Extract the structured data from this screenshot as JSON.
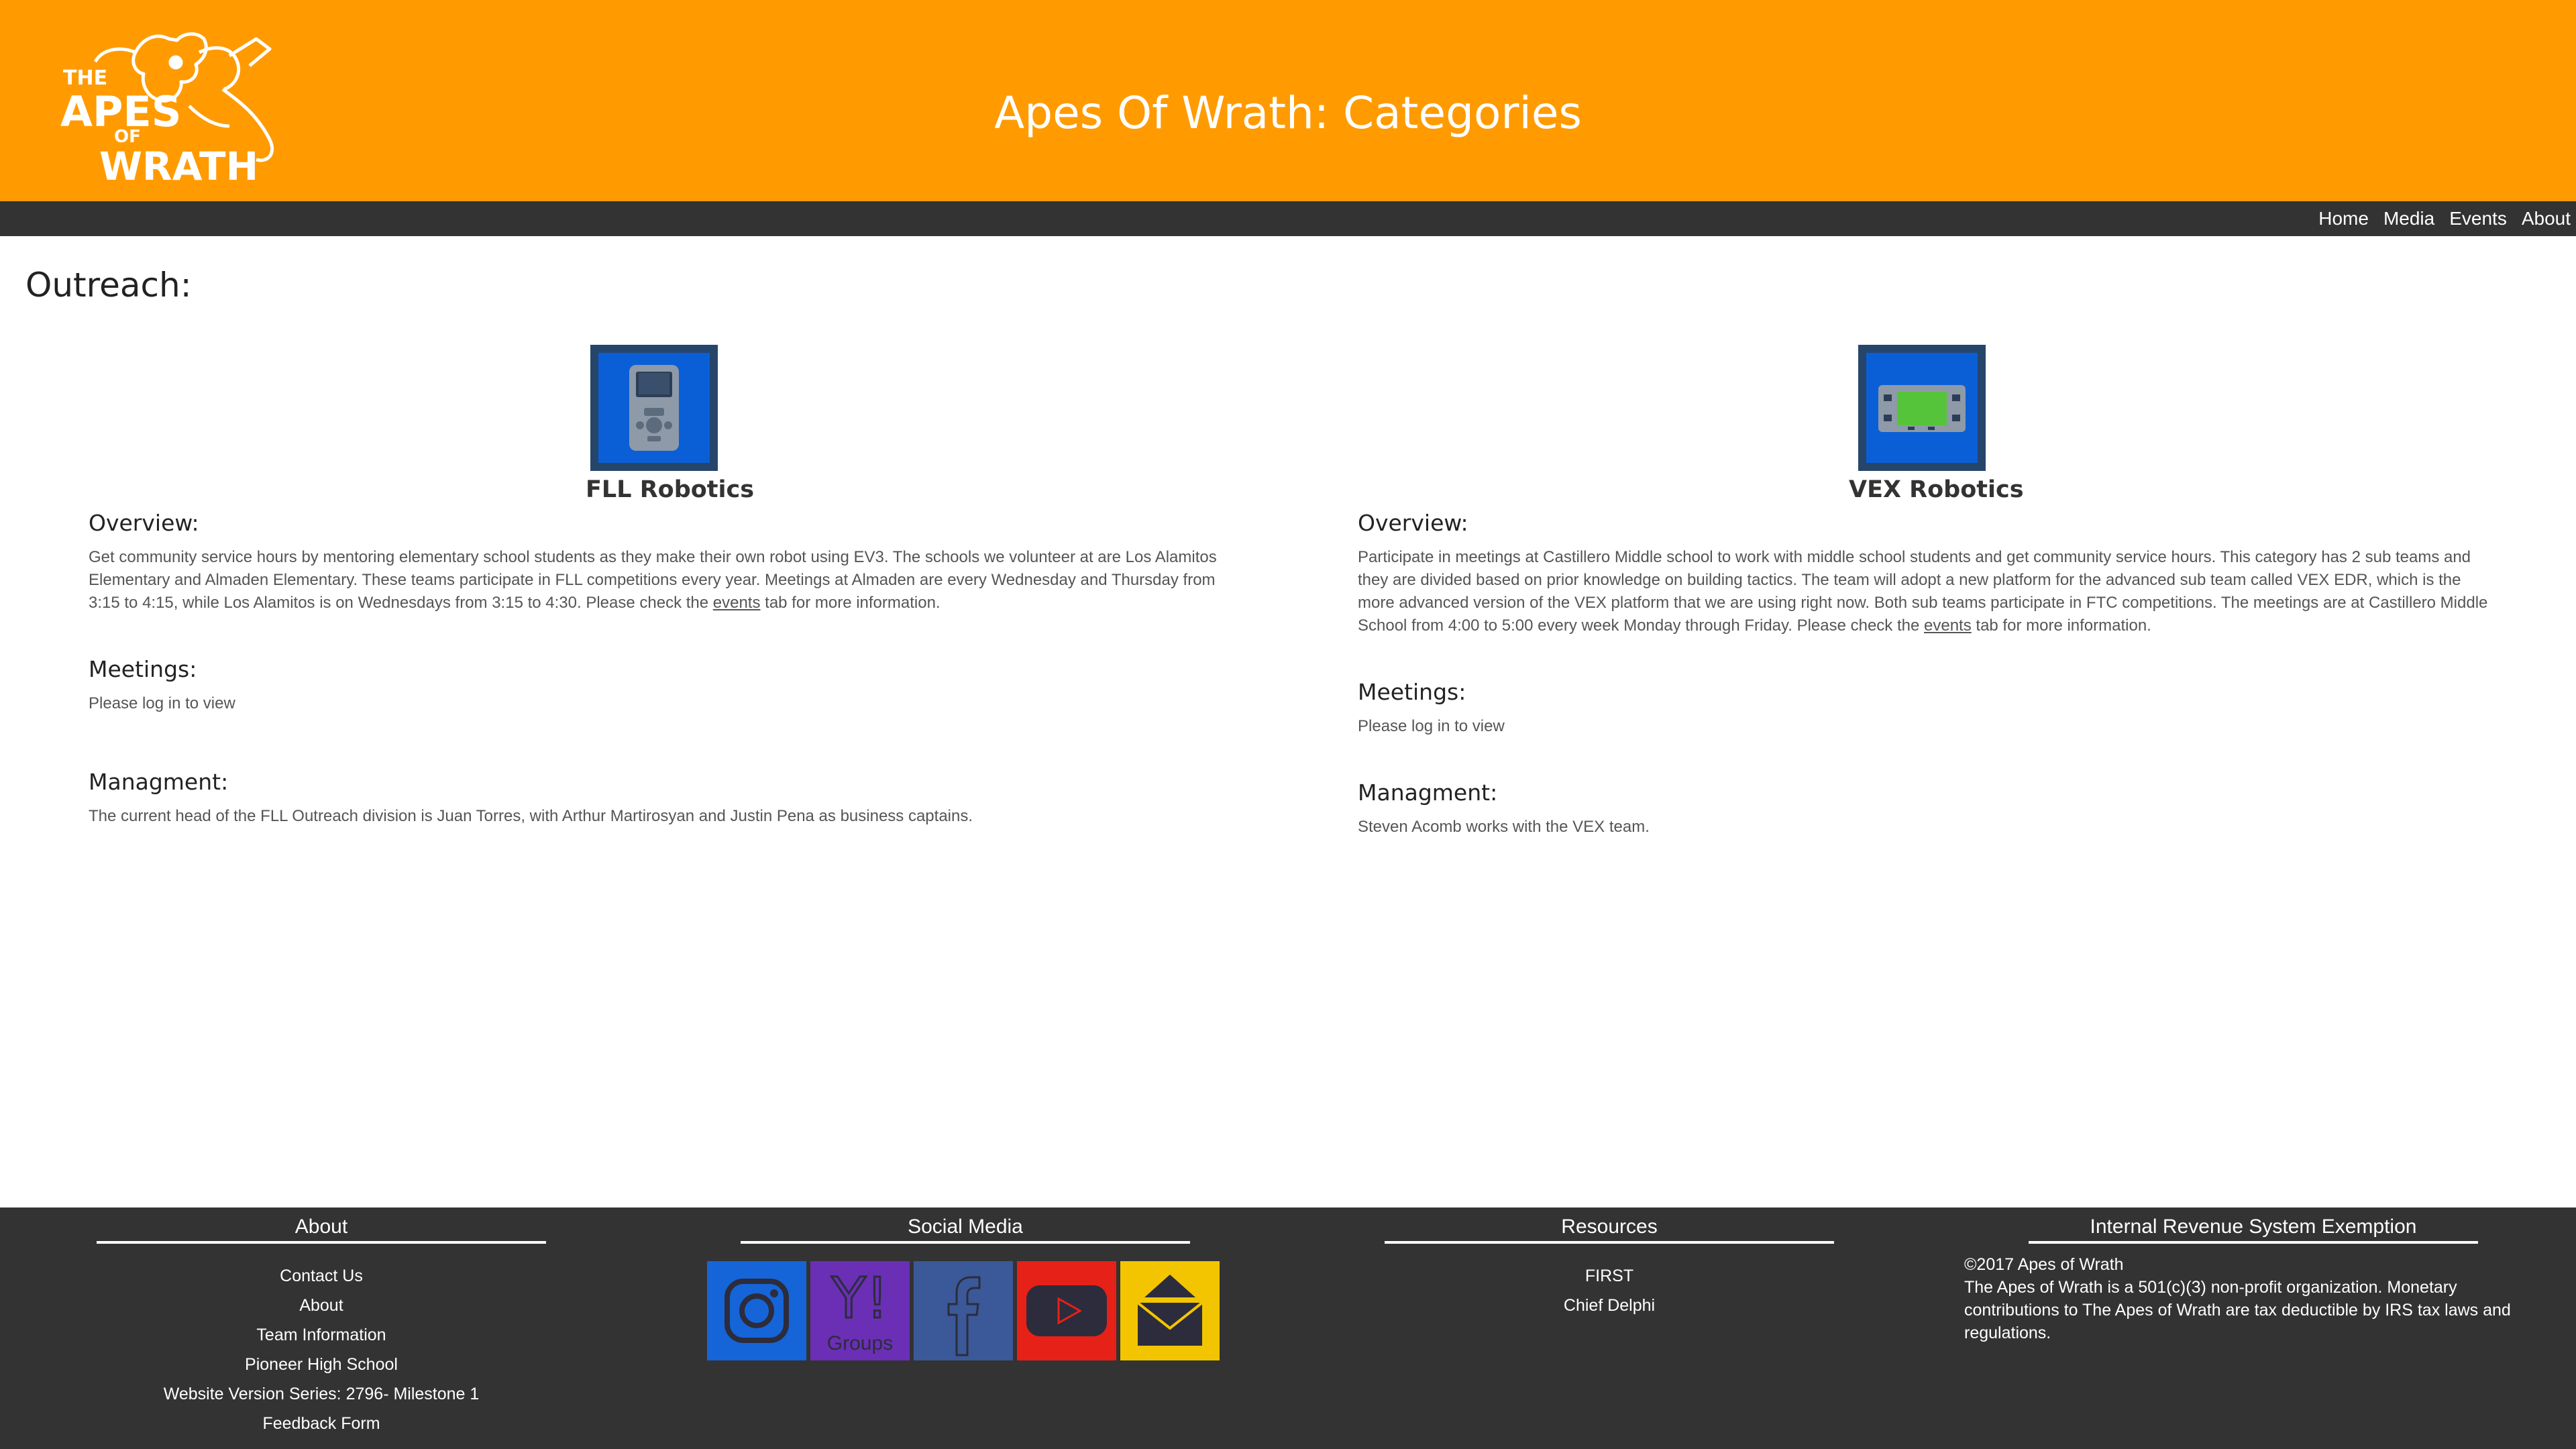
{
  "header": {
    "logo_text": [
      "THE",
      "APES",
      "OF",
      "WRATH"
    ],
    "title": "Apes Of Wrath: Categories"
  },
  "nav": {
    "items": [
      "Home",
      "Media",
      "Events",
      "About"
    ]
  },
  "main": {
    "section_title": "Outreach:",
    "cards": [
      {
        "title": "FLL Robotics",
        "icon": "ev3-brick-icon",
        "overview_head": "Overview:",
        "overview_text_before": "Get community service hours by mentoring elementary school students as they make their own robot using EV3. The schools we volunteer at are Los Alamitos Elementary and Almaden Elementary. These teams participate in FLL competitions every year. Meetings at Almaden are every Wednesday and Thursday from 3:15 to 4:15, while Los Alamitos is on Wednesdays from 3:15 to 4:30. Please check the ",
        "overview_link": "events",
        "overview_text_after": " tab for more information.",
        "meetings_head": "Meetings:",
        "meetings_text": "Please log in to view",
        "management_head": "Managment:",
        "management_text": "The current head of the FLL Outreach division is Juan Torres, with Arthur Martirosyan and Justin Pena as business captains."
      },
      {
        "title": "VEX Robotics",
        "icon": "vex-brain-icon",
        "overview_head": "Overview:",
        "overview_text_before": "Participate in meetings at Castillero Middle school to work with middle school students and get community service hours. This category has 2 sub teams and they are divided based on prior knowledge on building tactics. The team will adopt a new platform for the advanced sub team called VEX EDR, which is the more advanced version of the VEX platform that we are using right now. Both sub teams participate in FTC competitions. The meetings are at Castillero Middle School from 4:00 to 5:00 every week Monday through Friday. Please check the ",
        "overview_link": "events",
        "overview_text_after": " tab for more information.",
        "meetings_head": "Meetings:",
        "meetings_text": "Please log in to view",
        "management_head": "Managment:",
        "management_text": "Steven Acomb works with the VEX team."
      }
    ]
  },
  "footer": {
    "about": {
      "head": "About",
      "links": [
        "Contact Us",
        "About",
        "Team Information",
        "Pioneer High School",
        "Website Version Series: 2796- Milestone 1",
        "Feedback Form"
      ]
    },
    "social": {
      "head": "Social Media",
      "icons": [
        {
          "name": "instagram-icon",
          "color": "#1565d8"
        },
        {
          "name": "yahoo-groups-icon",
          "color": "#6a2fb5",
          "label": "Groups"
        },
        {
          "name": "facebook-icon",
          "color": "#3b5998"
        },
        {
          "name": "youtube-icon",
          "color": "#e62117"
        },
        {
          "name": "email-icon",
          "color": "#f2c500"
        }
      ]
    },
    "resources": {
      "head": "Resources",
      "links": [
        "FIRST",
        "Chief Delphi"
      ]
    },
    "irs": {
      "head": "Internal Revenue System Exemption",
      "copyright": "©2017 Apes of Wrath",
      "text": "The Apes of Wrath is a 501(c)(3) non-profit organization. Monetary contributions to The Apes of Wrath are tax deductible by IRS tax laws and regulations."
    }
  },
  "colors": {
    "header_orange": "#ff9b00",
    "navbar_dark": "#333333",
    "footer_dark": "#333333"
  }
}
